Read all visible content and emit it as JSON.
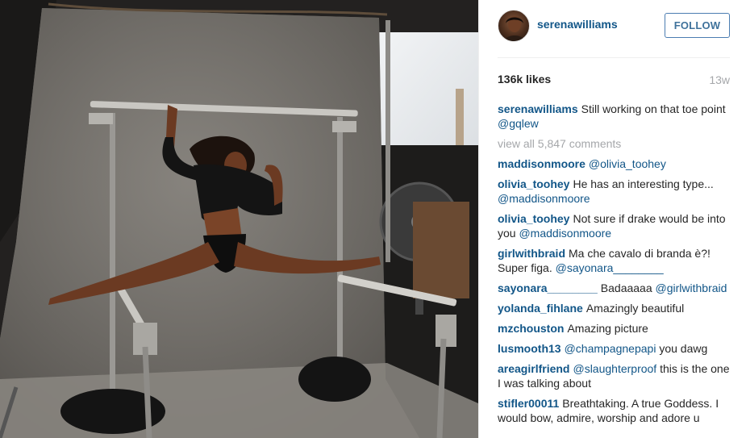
{
  "post": {
    "username": "serenawilliams",
    "follow_label": "FOLLOW",
    "likes": "136k likes",
    "age": "13w",
    "caption": {
      "author": "serenawilliams",
      "text": "Still working on that toe point",
      "mention": "@gqlew"
    },
    "view_all": "view all 5,847 comments",
    "comments": [
      {
        "author": "maddisonmoore",
        "text": "",
        "mention": "@olivia_toohey"
      },
      {
        "author": "olivia_toohey",
        "text": "He has an interesting type...",
        "mention": "@maddisonmoore"
      },
      {
        "author": "olivia_toohey",
        "text": "Not sure if drake would be into you",
        "mention": "@maddisonmoore"
      },
      {
        "author": "girlwithbraid",
        "text": "Ma che cavalo di branda è?! Super figa.",
        "mention": "@sayonara________"
      },
      {
        "author": "sayonara________",
        "text": "Badaaaaa",
        "mention": "@girlwithbraid"
      },
      {
        "author": "yolanda_fihlane",
        "text": "Amazingly beautiful",
        "mention": ""
      },
      {
        "author": "mzchouston",
        "text": "Amazing picture",
        "mention": ""
      },
      {
        "author": "lusmooth13",
        "text": "",
        "mention": "@champagnepapi",
        "after": "you dawg"
      },
      {
        "author": "areagirlfriend",
        "text": "",
        "mention": "@slaughterproof",
        "after": "this is the one I was talking about"
      },
      {
        "author": "stifler00011",
        "text": "Breathtaking. A true Goddess. I would bow, admire, worship and adore u",
        "mention": ""
      }
    ]
  },
  "colors": {
    "link": "#125688",
    "follow_border": "#4b7db1",
    "muted": "#a5a7aa",
    "text": "#262626"
  },
  "icons": [
    "avatar-photo"
  ]
}
